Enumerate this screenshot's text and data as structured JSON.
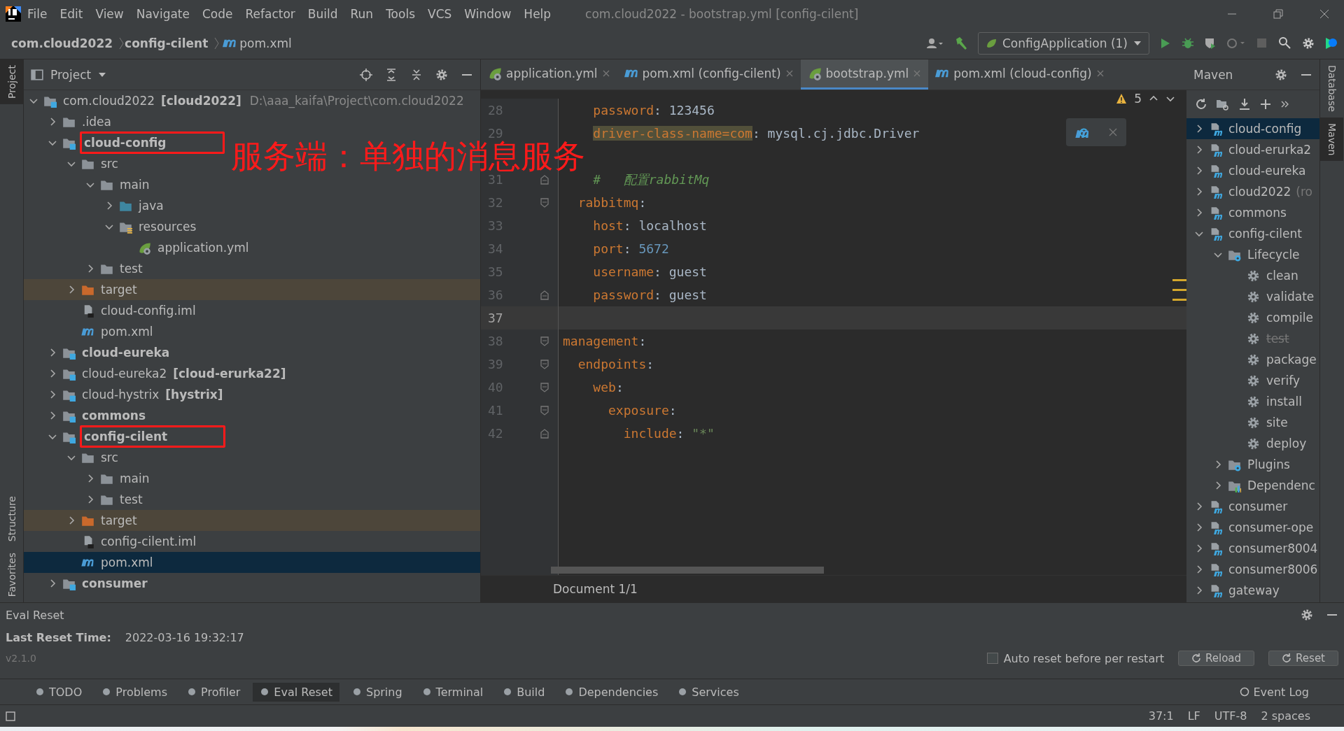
{
  "window": {
    "title": "com.cloud2022 - bootstrap.yml [config-cilent]"
  },
  "menu": [
    "File",
    "Edit",
    "View",
    "Navigate",
    "Code",
    "Refactor",
    "Build",
    "Run",
    "Tools",
    "VCS",
    "Window",
    "Help"
  ],
  "breadcrumb": [
    "com.cloud2022",
    "config-cilent",
    "pom.xml"
  ],
  "run_config": "ConfigApplication (1)",
  "side_left": [
    {
      "label": "Project",
      "selected": true
    },
    {
      "label": "Structure",
      "selected": false
    },
    {
      "label": "Favorites",
      "selected": false
    }
  ],
  "side_right": [
    {
      "label": "Database",
      "selected": false
    },
    {
      "label": "Maven",
      "selected": true
    }
  ],
  "project": {
    "title": "Project",
    "tree": [
      {
        "name": "com.cloud2022",
        "suffix": "[cloud2022]",
        "path": "D:\\aaa_kaifa\\Project\\com.cloud2022",
        "kind": "module",
        "bold": false,
        "expanded": true,
        "selected": false,
        "children": [
          {
            "name": ".idea",
            "kind": "folder",
            "bold": false,
            "expanded": false,
            "selected": false
          },
          {
            "name": "cloud-config",
            "kind": "module",
            "bold": true,
            "boxed": true,
            "expanded": true,
            "selected": false,
            "children": [
              {
                "name": "src",
                "kind": "folder",
                "bold": false,
                "expanded": true,
                "selected": false,
                "children": [
                  {
                    "name": "main",
                    "kind": "folder",
                    "bold": false,
                    "expanded": true,
                    "selected": false,
                    "children": [
                      {
                        "name": "java",
                        "kind": "source",
                        "bold": false,
                        "expanded": false,
                        "selected": false
                      },
                      {
                        "name": "resources",
                        "kind": "resources",
                        "bold": false,
                        "expanded": true,
                        "selected": false,
                        "children": [
                          {
                            "name": "application.yml",
                            "kind": "yml",
                            "bold": false,
                            "selected": false
                          }
                        ]
                      }
                    ]
                  },
                  {
                    "name": "test",
                    "kind": "folder",
                    "bold": false,
                    "expanded": false,
                    "selected": false
                  }
                ]
              },
              {
                "name": "target",
                "kind": "excluded",
                "bold": false,
                "expanded": false,
                "selected": false
              },
              {
                "name": "cloud-config.iml",
                "kind": "iml",
                "bold": false,
                "selected": false
              },
              {
                "name": "pom.xml",
                "kind": "maven",
                "bold": false,
                "selected": false
              }
            ]
          },
          {
            "name": "cloud-eureka",
            "kind": "module",
            "bold": true,
            "expanded": false,
            "selected": false
          },
          {
            "name": "cloud-eureka2",
            "suffix": "[cloud-erurka22]",
            "kind": "module",
            "bold": false,
            "expanded": false,
            "selected": false
          },
          {
            "name": "cloud-hystrix",
            "suffix": "[hystrix]",
            "kind": "module",
            "bold": false,
            "expanded": false,
            "selected": false
          },
          {
            "name": "commons",
            "kind": "module",
            "bold": true,
            "expanded": false,
            "selected": false
          },
          {
            "name": "config-cilent",
            "kind": "module",
            "bold": true,
            "boxed": true,
            "expanded": true,
            "selected": false,
            "children": [
              {
                "name": "src",
                "kind": "folder",
                "bold": false,
                "expanded": true,
                "selected": false,
                "children": [
                  {
                    "name": "main",
                    "kind": "folder",
                    "bold": false,
                    "expanded": false,
                    "selected": false
                  },
                  {
                    "name": "test",
                    "kind": "folder",
                    "bold": false,
                    "expanded": false,
                    "selected": false
                  }
                ]
              },
              {
                "name": "target",
                "kind": "excluded",
                "bold": false,
                "expanded": false,
                "selected": false
              },
              {
                "name": "config-cilent.iml",
                "kind": "iml",
                "bold": false,
                "selected": false
              },
              {
                "name": "pom.xml",
                "kind": "maven",
                "bold": false,
                "selected": true
              }
            ]
          },
          {
            "name": "consumer",
            "kind": "module",
            "bold": true,
            "expanded": false,
            "selected": false
          }
        ]
      }
    ]
  },
  "annotation": "服务端：单独的消息服务",
  "editor": {
    "tabs": [
      {
        "label": "application.yml",
        "kind": "yml",
        "selected": false
      },
      {
        "label": "pom.xml (config-cilent)",
        "kind": "maven",
        "selected": false
      },
      {
        "label": "bootstrap.yml",
        "kind": "yml",
        "selected": true
      },
      {
        "label": "pom.xml (cloud-config)",
        "kind": "maven",
        "selected": false
      }
    ],
    "warnings": "5",
    "lines": [
      {
        "number": "28",
        "current": false,
        "tokens": [
          {
            "kind": "key",
            "text": "    password"
          },
          {
            "kind": "plain",
            "text": ": 123456"
          }
        ]
      },
      {
        "number": "29",
        "current": false,
        "tokens": [
          {
            "kind": "key-warn",
            "text": "    driver-class-name=com"
          },
          {
            "kind": "plain",
            "text": ": mysql.cj.jdbc.Driver"
          }
        ]
      },
      {
        "current": false
      },
      {
        "number": "31",
        "fold_close": true,
        "current": false,
        "tokens": [
          {
            "kind": "comment",
            "text": "    #   配置rabbitMq"
          }
        ]
      },
      {
        "number": "32",
        "fold_open": true,
        "current": false,
        "tokens": [
          {
            "kind": "key",
            "text": "  rabbitmq"
          },
          {
            "kind": "plain",
            "text": ":"
          }
        ]
      },
      {
        "number": "33",
        "current": false,
        "tokens": [
          {
            "kind": "key",
            "text": "    host"
          },
          {
            "kind": "plain",
            "text": ": localhost"
          }
        ]
      },
      {
        "number": "34",
        "current": false,
        "tokens": [
          {
            "kind": "key",
            "text": "    port"
          },
          {
            "kind": "plain",
            "text": ": "
          },
          {
            "kind": "number",
            "text": "5672"
          }
        ]
      },
      {
        "number": "35",
        "current": false,
        "tokens": [
          {
            "kind": "key",
            "text": "    username"
          },
          {
            "kind": "plain",
            "text": ": guest"
          }
        ]
      },
      {
        "number": "36",
        "fold_close": true,
        "current": false,
        "tokens": [
          {
            "kind": "key",
            "text": "    password"
          },
          {
            "kind": "plain",
            "text": ": guest"
          }
        ]
      },
      {
        "number": "37",
        "current": true
      },
      {
        "number": "38",
        "fold_open": true,
        "current": false,
        "tokens": [
          {
            "kind": "key",
            "text": "management"
          },
          {
            "kind": "plain",
            "text": ":"
          }
        ]
      },
      {
        "number": "39",
        "fold_open": true,
        "current": false,
        "tokens": [
          {
            "kind": "key",
            "text": "  endpoints"
          },
          {
            "kind": "plain",
            "text": ":"
          }
        ]
      },
      {
        "number": "40",
        "fold_open": true,
        "current": false,
        "tokens": [
          {
            "kind": "key",
            "text": "    web"
          },
          {
            "kind": "plain",
            "text": ":"
          }
        ]
      },
      {
        "number": "41",
        "fold_open": true,
        "current": false,
        "tokens": [
          {
            "kind": "key",
            "text": "      exposure"
          },
          {
            "kind": "plain",
            "text": ":"
          }
        ]
      },
      {
        "number": "42",
        "fold_close": true,
        "current": false,
        "tokens": [
          {
            "kind": "key",
            "text": "        include"
          },
          {
            "kind": "plain",
            "text": ": "
          },
          {
            "kind": "string",
            "text": "\"*\""
          }
        ]
      }
    ],
    "footer": "Document 1/1"
  },
  "maven": {
    "title": "Maven",
    "tree": [
      {
        "name": "cloud-config",
        "kind": "mvn-module",
        "expanded": false,
        "selected": true,
        "disabled": false
      },
      {
        "name": "cloud-erurka2",
        "kind": "mvn-module",
        "expanded": false,
        "selected": false,
        "disabled": false
      },
      {
        "name": "cloud-eureka",
        "kind": "mvn-module",
        "expanded": false,
        "selected": false,
        "disabled": false
      },
      {
        "name": "cloud2022",
        "note": "(ro",
        "kind": "mvn-module",
        "expanded": false,
        "selected": false,
        "disabled": false
      },
      {
        "name": "commons",
        "kind": "mvn-module",
        "expanded": false,
        "selected": false,
        "disabled": false
      },
      {
        "name": "config-cilent",
        "kind": "mvn-module",
        "expanded": true,
        "selected": false,
        "disabled": false,
        "children": [
          {
            "name": "Lifecycle",
            "kind": "gear-folder",
            "expanded": true,
            "selected": false,
            "disabled": false,
            "children": [
              {
                "name": "clean",
                "kind": "goal",
                "selected": false,
                "disabled": false
              },
              {
                "name": "validate",
                "kind": "goal",
                "selected": false,
                "disabled": false
              },
              {
                "name": "compile",
                "kind": "goal",
                "selected": false,
                "disabled": false
              },
              {
                "name": "test",
                "kind": "goal",
                "selected": false,
                "disabled": true
              },
              {
                "name": "package",
                "kind": "goal",
                "selected": false,
                "disabled": false
              },
              {
                "name": "verify",
                "kind": "goal",
                "selected": false,
                "disabled": false
              },
              {
                "name": "install",
                "kind": "goal",
                "selected": false,
                "disabled": false
              },
              {
                "name": "site",
                "kind": "goal",
                "selected": false,
                "disabled": false
              },
              {
                "name": "deploy",
                "kind": "goal",
                "selected": false,
                "disabled": false
              }
            ]
          },
          {
            "name": "Plugins",
            "kind": "gear-folder",
            "expanded": false,
            "selected": false,
            "disabled": false
          },
          {
            "name": "Dependenc",
            "kind": "chart-folder",
            "expanded": false,
            "selected": false,
            "disabled": false
          }
        ]
      },
      {
        "name": "consumer",
        "kind": "mvn-module",
        "expanded": false,
        "selected": false,
        "disabled": false
      },
      {
        "name": "consumer-ope",
        "kind": "mvn-module",
        "expanded": false,
        "selected": false,
        "disabled": false
      },
      {
        "name": "consumer8004",
        "kind": "mvn-module",
        "expanded": false,
        "selected": false,
        "disabled": false
      },
      {
        "name": "consumer8006",
        "kind": "mvn-module",
        "expanded": false,
        "selected": false,
        "disabled": false
      },
      {
        "name": "gateway",
        "kind": "mvn-module",
        "expanded": false,
        "selected": false,
        "disabled": false
      }
    ]
  },
  "eval_reset": {
    "title": "Eval Reset",
    "label": "Last Reset Time:",
    "value": "2022-03-16 19:32:17",
    "version": "v2.1.0",
    "checkbox": {
      "label": "Auto reset before per restart",
      "checked": false
    },
    "buttons": [
      "Reload",
      "Reset"
    ]
  },
  "tool_windows": [
    {
      "label": "TODO",
      "selected": false
    },
    {
      "label": "Problems",
      "selected": false
    },
    {
      "label": "Profiler",
      "selected": false
    },
    {
      "label": "Eval Reset",
      "selected": true
    },
    {
      "label": "Spring",
      "selected": false
    },
    {
      "label": "Terminal",
      "selected": false
    },
    {
      "label": "Build",
      "selected": false
    },
    {
      "label": "Dependencies",
      "selected": false
    },
    {
      "label": "Services",
      "selected": false
    }
  ],
  "event_log": "Event Log",
  "status_bar": [
    "37:1",
    "LF",
    "UTF-8",
    "2 spaces"
  ]
}
